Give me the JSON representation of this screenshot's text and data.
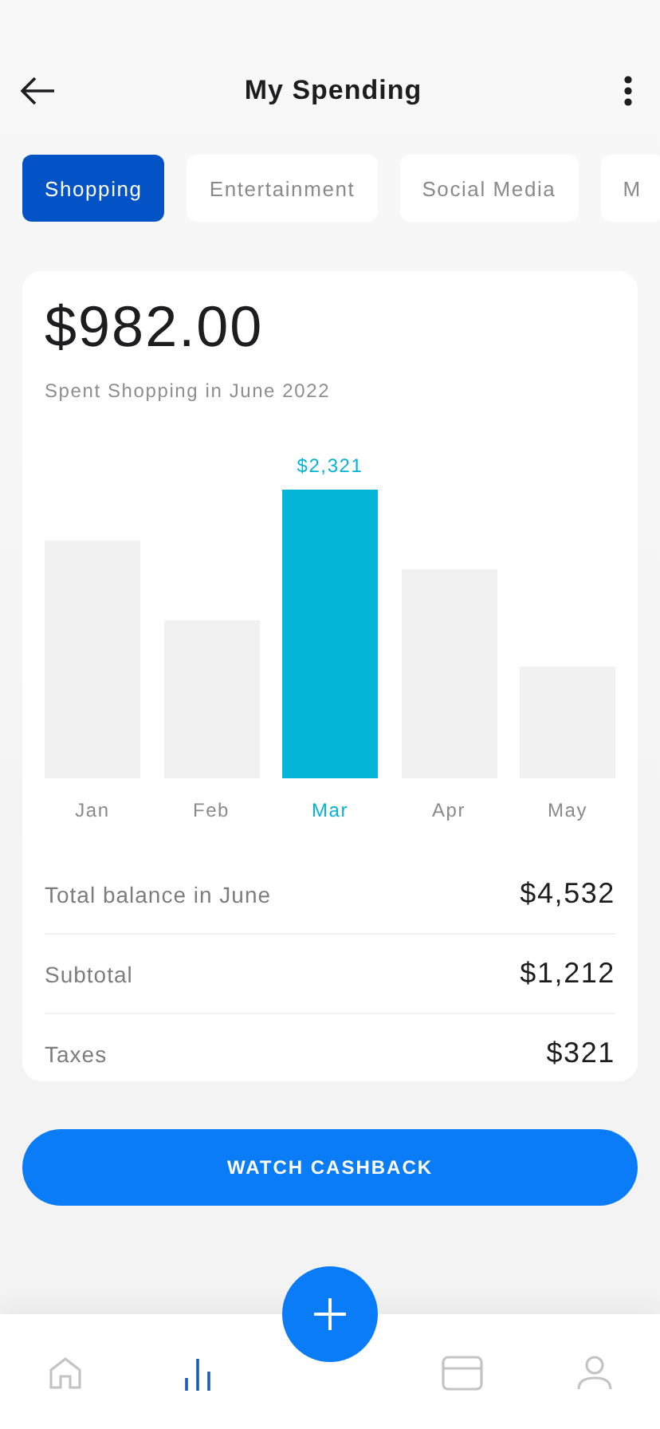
{
  "header": {
    "title": "My Spending"
  },
  "tabs": [
    {
      "label": "Shopping",
      "selected": true
    },
    {
      "label": "Entertainment",
      "selected": false
    },
    {
      "label": "Social Media",
      "selected": false
    },
    {
      "label": "M",
      "selected": false
    }
  ],
  "summary": {
    "amount": "$982.00",
    "caption": "Spent Shopping in June 2022"
  },
  "bars": [
    {
      "month": "Jan",
      "selected": false
    },
    {
      "month": "Feb",
      "selected": false
    },
    {
      "month": "Mar",
      "selected": true,
      "value": "$2,321"
    },
    {
      "month": "Apr",
      "selected": false
    },
    {
      "month": "May",
      "selected": false
    }
  ],
  "totals": [
    {
      "label": "Total balance in June",
      "value": "$4,532"
    },
    {
      "label": "Subtotal",
      "value": "$1,212"
    },
    {
      "label": "Taxes",
      "value": "$321"
    }
  ],
  "action": {
    "label": "WATCH CASHBACK"
  },
  "nav": [
    {
      "kind": "home",
      "selected": false
    },
    {
      "kind": "stats",
      "selected": true
    },
    {
      "kind": "card",
      "selected": false
    },
    {
      "kind": "profile",
      "selected": false
    }
  ]
}
